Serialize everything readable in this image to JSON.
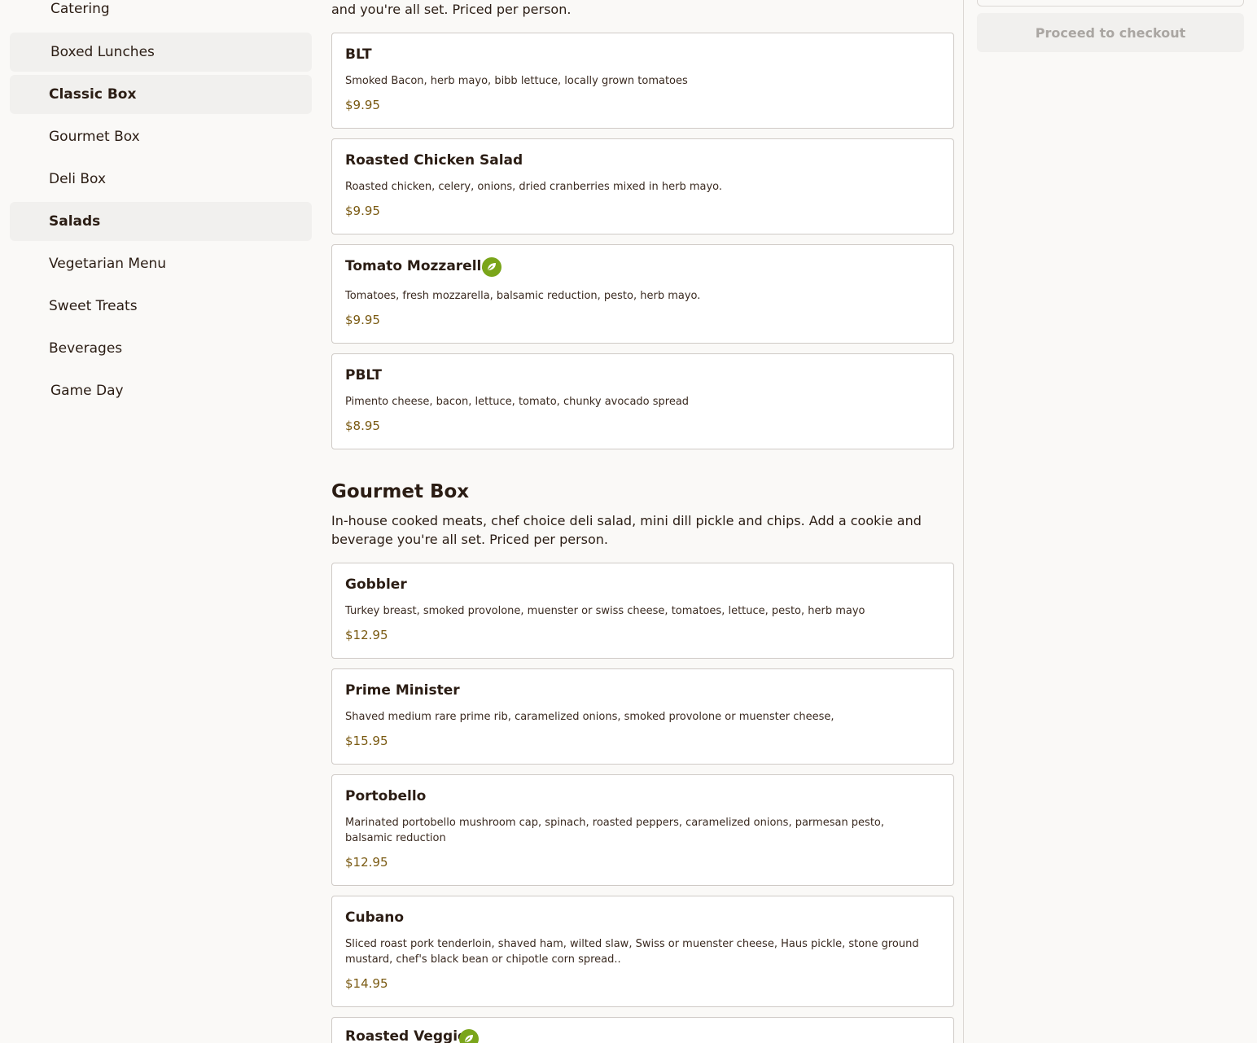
{
  "sidebar": {
    "items": [
      {
        "label": "Catering"
      },
      {
        "label": "Boxed Lunches"
      },
      {
        "label": "Classic Box"
      },
      {
        "label": "Gourmet Box"
      },
      {
        "label": "Deli Box"
      },
      {
        "label": "Salads"
      },
      {
        "label": "Vegetarian Menu"
      },
      {
        "label": "Sweet Treats"
      },
      {
        "label": "Beverages"
      },
      {
        "label": "Game Day"
      }
    ]
  },
  "classic_box": {
    "intro_tail": "and you're all set. Priced per person.",
    "items": [
      {
        "name": "BLT",
        "description": "Smoked Bacon, herb mayo, bibb lettuce, locally grown tomatoes",
        "price": "$9.95"
      },
      {
        "name": "Roasted Chicken Salad",
        "description": "Roasted chicken, celery, onions, dried cranberries mixed in herb mayo.",
        "price": "$9.95"
      },
      {
        "name": "Tomato Mozzarella",
        "description": "Tomatoes, fresh mozzarella, balsamic reduction, pesto, herb mayo.",
        "price": "$9.95",
        "icon": "vegetarian-leaf-icon"
      },
      {
        "name": "PBLT",
        "description": "Pimento cheese, bacon, lettuce, tomato, chunky avocado spread",
        "price": "$8.95"
      }
    ]
  },
  "gourmet_box": {
    "title": "Gourmet Box",
    "description": "In-house cooked meats, chef choice deli salad, mini dill pickle and chips. Add a cookie and beverage you're all set. Priced per person.",
    "items": [
      {
        "name": "Gobbler",
        "description": "Turkey breast, smoked provolone, muenster or swiss cheese, tomatoes, lettuce, pesto, herb mayo",
        "price": "$12.95"
      },
      {
        "name": "Prime Minister",
        "description": "Shaved medium rare prime rib, caramelized onions, smoked provolone or muenster cheese,",
        "price": "$15.95"
      },
      {
        "name": "Portobello",
        "description": "Marinated portobello mushroom cap, spinach, roasted peppers, caramelized onions, parmesan pesto, balsamic reduction",
        "price": "$12.95"
      },
      {
        "name": "Cubano",
        "description": "Sliced roast pork tenderloin, shaved ham, wilted slaw, Swiss or muenster cheese, Haus pickle, stone ground mustard, chef's black bean or chipotle corn spread..",
        "price": "$14.95"
      },
      {
        "name": "Roasted Veggie",
        "icon": "vegetarian-leaf-icon"
      }
    ]
  },
  "cart": {
    "checkout_label": "Proceed to checkout"
  },
  "colors": {
    "background": "#faf9f7",
    "price": "#7a5a12",
    "veg_icon": "#7aa51a",
    "nav_highlight": "#f1f0ee"
  }
}
